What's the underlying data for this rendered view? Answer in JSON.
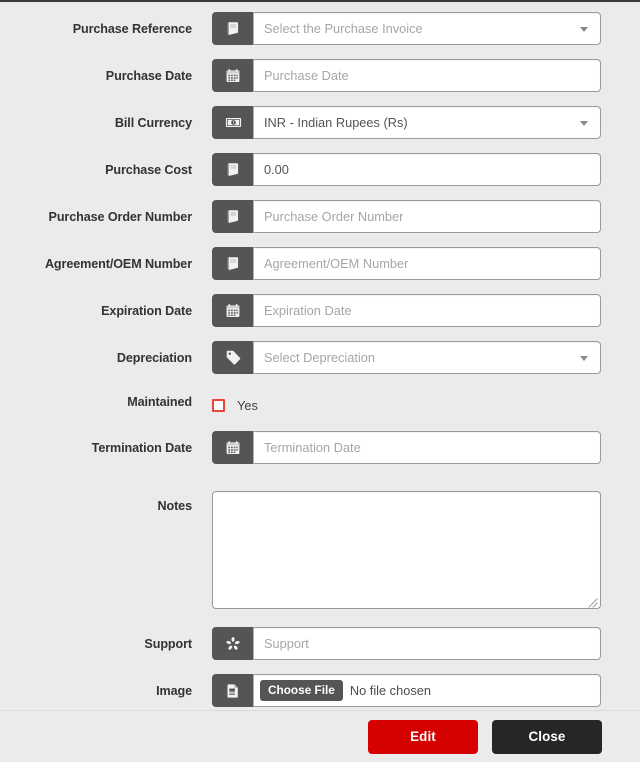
{
  "form": {
    "rows": [
      {
        "label": "Purchase Reference",
        "control": "select",
        "icon": "note-book-icon",
        "text": "Select the Purchase Invoice",
        "is_placeholder": true
      },
      {
        "label": "Purchase Date",
        "control": "text",
        "icon": "calendar-icon",
        "text": "Purchase Date",
        "is_placeholder": true
      },
      {
        "label": "Bill Currency",
        "control": "select",
        "icon": "money-bill-icon",
        "text": "INR - Indian Rupees (Rs)",
        "is_placeholder": false
      },
      {
        "label": "Purchase Cost",
        "control": "text",
        "icon": "note-book-icon",
        "text": "0.00",
        "is_placeholder": false
      },
      {
        "label": "Purchase Order Number",
        "control": "text",
        "icon": "note-book-icon",
        "text": "Purchase Order Number",
        "is_placeholder": true
      },
      {
        "label": "Agreement/OEM Number",
        "control": "text",
        "icon": "note-book-icon",
        "text": "Agreement/OEM Number",
        "is_placeholder": true
      },
      {
        "label": "Expiration Date",
        "control": "text",
        "icon": "calendar-icon",
        "text": "Expiration Date",
        "is_placeholder": true
      },
      {
        "label": "Depreciation",
        "control": "select",
        "icon": "tag-icon",
        "text": "Select Depreciation",
        "is_placeholder": true
      }
    ],
    "maintained": {
      "label": "Maintained",
      "checkbox_label": "Yes",
      "checked": false,
      "checkbox_border_color": "#e8443a"
    },
    "termination": {
      "label": "Termination Date",
      "icon": "calendar-icon",
      "placeholder": "Termination Date",
      "value": ""
    },
    "notes": {
      "label": "Notes",
      "value": "",
      "resize_handle": "resize-grip-icon"
    },
    "support": {
      "label": "Support",
      "icon": "support-asterisk-icon",
      "placeholder": "Support",
      "value": ""
    },
    "image": {
      "label": "Image",
      "icon": "file-document-icon",
      "choose_button": "Choose File",
      "file_status": "No file chosen"
    }
  },
  "footer": {
    "edit_label": "Edit",
    "close_label": "Close",
    "edit_color": "#d50000",
    "close_color": "#262626"
  }
}
